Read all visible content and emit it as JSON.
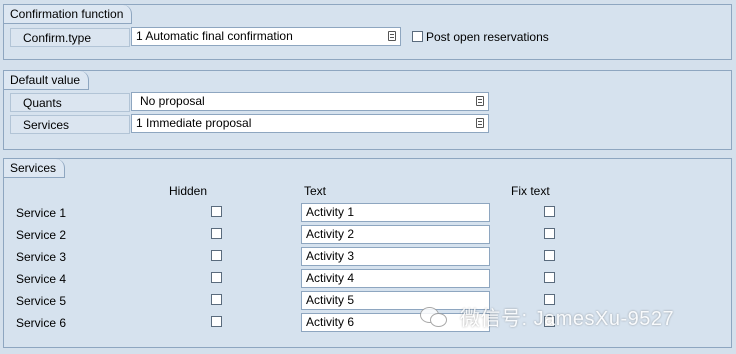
{
  "confirmation": {
    "title": "Confirmation function",
    "confirm_type_label": "Confirm.type",
    "confirm_type_value": "1 Automatic final confirmation",
    "post_open_label": "Post open reservations"
  },
  "defaults": {
    "title": "Default value",
    "quants_label": "Quants",
    "quants_value": "No proposal",
    "services_label": "Services",
    "services_value": "1 Immediate proposal"
  },
  "services": {
    "title": "Services",
    "col_hidden": "Hidden",
    "col_text": "Text",
    "col_fix": "Fix text",
    "rows": [
      {
        "label": "Service 1",
        "text": "Activity 1"
      },
      {
        "label": "Service 2",
        "text": "Activity 2"
      },
      {
        "label": "Service 3",
        "text": "Activity 3"
      },
      {
        "label": "Service 4",
        "text": "Activity 4"
      },
      {
        "label": "Service 5",
        "text": "Activity 5"
      },
      {
        "label": "Service 6",
        "text": "Activity 6"
      }
    ]
  },
  "watermark": "微信号: JamesXu-9527",
  "icons": {
    "dropdown": "f4-help-icon",
    "wechat": "wechat-icon"
  },
  "colors": {
    "background": "#d4e0ec",
    "border": "#8ea6c0",
    "field": "#ffffff"
  }
}
